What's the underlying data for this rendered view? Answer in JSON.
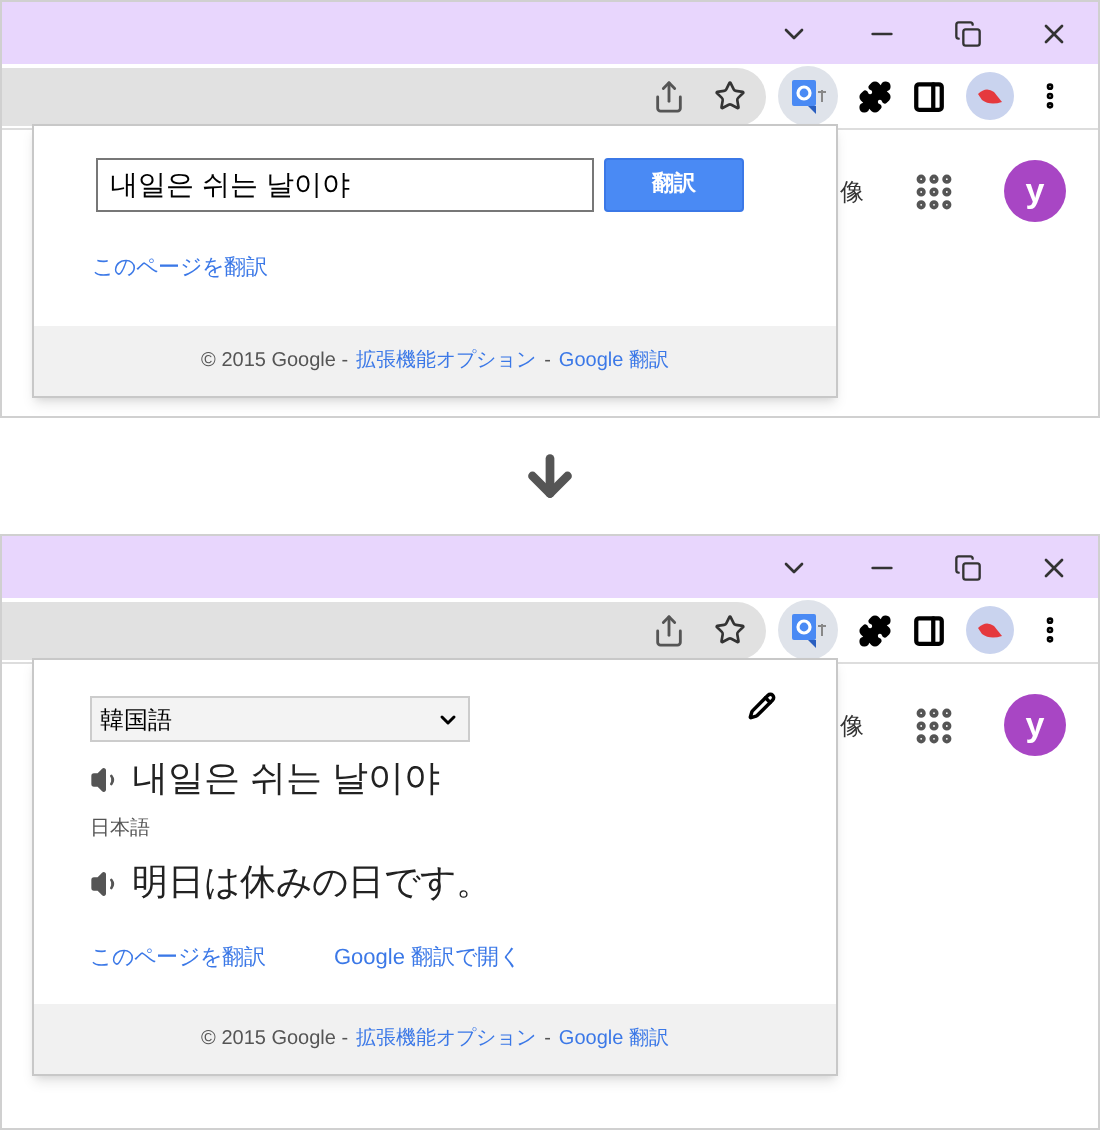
{
  "screens": [
    {
      "kind": "input",
      "partial_text": "像",
      "avatar": "y",
      "input_value": "내일은 쉬는 날이야",
      "translate_button": "翻訳",
      "page_link": "このページを翻訳",
      "footer": {
        "prefix": "© 2015 Google -",
        "options_link": "拡張機能オプション",
        "separator": "-",
        "translate_link": "Google 翻訳"
      }
    },
    {
      "kind": "result",
      "partial_text": "像",
      "avatar": "y",
      "source_language": "韓国語",
      "source_text": "내일은 쉬는 날이야",
      "target_language": "日本語",
      "translated_text": "明日は休みの日です。",
      "page_link": "このページを翻訳",
      "open_link": "Google 翻訳で開く",
      "footer": {
        "prefix": "© 2015 Google -",
        "options_link": "拡張機能オプション",
        "separator": "-",
        "translate_link": "Google 翻訳"
      }
    }
  ]
}
